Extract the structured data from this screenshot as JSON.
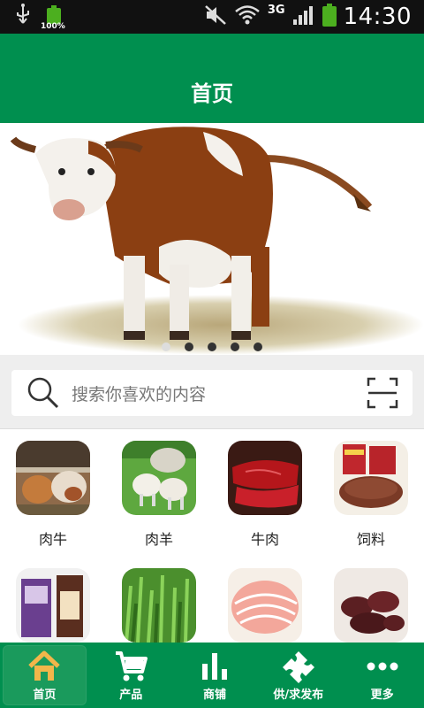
{
  "status_bar": {
    "battery_small_pct": "100%",
    "network": "3G",
    "time": "14:30"
  },
  "header": {
    "title": "首页"
  },
  "banner": {
    "dots": 5,
    "active_index": 0
  },
  "search": {
    "placeholder": "搜索你喜欢的内容"
  },
  "categories": [
    {
      "label": "肉牛"
    },
    {
      "label": "肉羊"
    },
    {
      "label": "牛肉"
    },
    {
      "label": "饲料"
    },
    {
      "label": ""
    },
    {
      "label": ""
    },
    {
      "label": ""
    },
    {
      "label": ""
    }
  ],
  "bottom_nav": {
    "items": [
      {
        "label": "首页",
        "icon": "home-icon"
      },
      {
        "label": "产品",
        "icon": "cart-icon"
      },
      {
        "label": "商铺",
        "icon": "bar-chart-icon"
      },
      {
        "label": "供/求发布",
        "icon": "puzzle-icon"
      },
      {
        "label": "更多",
        "icon": "more-icon"
      }
    ],
    "active_index": 0
  },
  "colors": {
    "brand_green": "#008f4f",
    "nav_active": "#1a9a5c"
  }
}
